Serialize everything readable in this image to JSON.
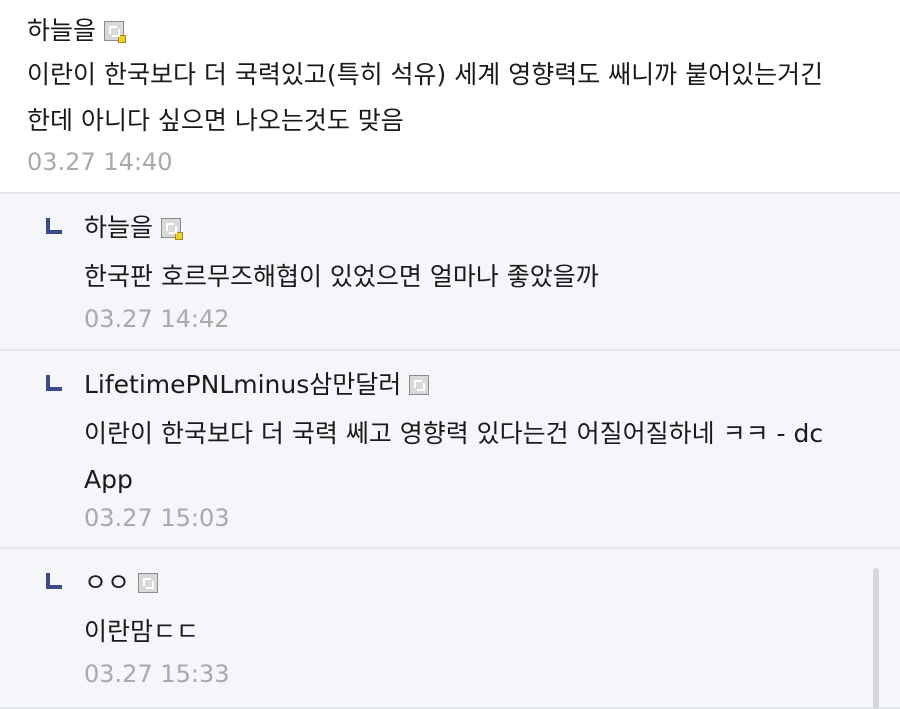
{
  "comments": [
    {
      "nickname": "하늘을",
      "badge_icon": "gallery-badge-icon",
      "text_lines": [
        "이란이 한국보다 더 국력있고(특히 석유) 세계 영향력도 쌔니까 붙어있는거긴",
        "한데 아니다 싶으면 나오는것도 맞음"
      ],
      "timestamp": "03.27 14:40"
    }
  ],
  "replies": [
    {
      "nickname": "하늘을",
      "badge_icon": "gallery-badge-icon",
      "text_lines": [
        "한국판 호르무즈해협이 있었으면 얼마나 좋았을까"
      ],
      "timestamp": "03.27 14:42"
    },
    {
      "nickname": "LifetimePNLminus삼만달러",
      "badge_icon": "gallery-badge-icon",
      "text_lines": [
        "이란이 한국보다 더 국력 쎄고 영향력 있다는건 어질어질하네 ㅋㅋ - dc",
        "App"
      ],
      "timestamp": "03.27 15:03"
    },
    {
      "nickname": "ㅇㅇ",
      "badge_icon": "gallery-badge-icon",
      "text_lines": [
        "이란맘ㄷㄷ"
      ],
      "timestamp": "03.27 15:33"
    }
  ],
  "colors": {
    "reply_background": "#f4f6fa",
    "reply_arrow": "#3c4a8a",
    "timestamp": "#a9a9a9",
    "text": "#1a1a1a"
  }
}
